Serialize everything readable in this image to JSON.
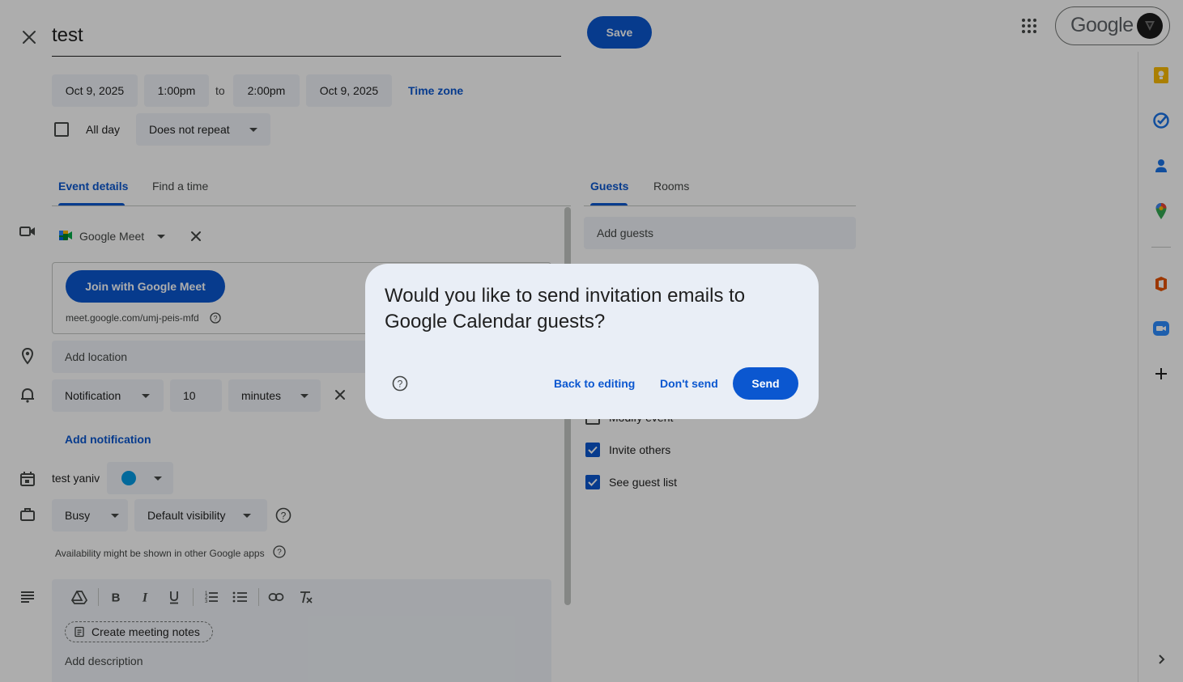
{
  "header": {
    "event_title": "test",
    "save_label": "Save",
    "brand": "Google"
  },
  "datetime": {
    "start_date": "Oct 9, 2025",
    "start_time": "1:00pm",
    "to": "to",
    "end_time": "2:00pm",
    "end_date": "Oct 9, 2025",
    "timezone_label": "Time zone",
    "all_day_label": "All day",
    "repeat_value": "Does not repeat"
  },
  "tabs": {
    "event_details": "Event details",
    "find_time": "Find a time",
    "guests": "Guests",
    "rooms": "Rooms"
  },
  "conference": {
    "provider": "Google Meet",
    "join_label": "Join with Google Meet",
    "url": "meet.google.com/umj-peis-mfd"
  },
  "location": {
    "placeholder": "Add location"
  },
  "notification": {
    "type": "Notification",
    "amount": "10",
    "unit": "minutes",
    "add_label": "Add notification"
  },
  "calendar": {
    "name": "test yaniv",
    "color": "#039be5"
  },
  "availability": {
    "status": "Busy",
    "visibility": "Default visibility",
    "note": "Availability might be shown in other Google apps"
  },
  "description": {
    "notes_chip": "Create meeting notes",
    "placeholder": "Add description"
  },
  "guests": {
    "add_placeholder": "Add guests",
    "permissions": [
      {
        "label": "Modify event",
        "checked": false
      },
      {
        "label": "Invite others",
        "checked": true
      },
      {
        "label": "See guest list",
        "checked": true
      }
    ]
  },
  "dialog": {
    "title": "Would you like to send invitation emails to Google Calendar guests?",
    "back_label": "Back to editing",
    "dont_send_label": "Don't send",
    "send_label": "Send"
  },
  "colors": {
    "accent": "#0b57d0",
    "chip_bg": "#f0f4f9",
    "dialog_bg": "#e9eef6"
  }
}
